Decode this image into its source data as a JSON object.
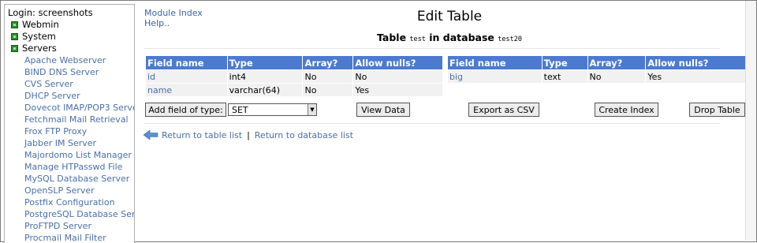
{
  "nav": {
    "login": "Login: screenshots",
    "categories": [
      {
        "label": "Webmin",
        "icon": "category-icon"
      },
      {
        "label": "System",
        "icon": "category-icon"
      },
      {
        "label": "Servers",
        "icon": "category-icon"
      }
    ],
    "modules": [
      "Apache Webserver",
      "BIND DNS Server",
      "CVS Server",
      "DHCP Server",
      "Dovecot IMAP/POP3 Server",
      "Fetchmail Mail Retrieval",
      "Frox FTP Proxy",
      "Jabber IM Server",
      "Majordomo List Manager",
      "Manage HTPasswd File",
      "MySQL Database Server",
      "OpenSLP Server",
      "Postfix Configuration",
      "PostgreSQL Database Server",
      "ProFTPD Server",
      "Procmail Mail Filter"
    ]
  },
  "links": {
    "module_index": "Module Index",
    "help": "Help.."
  },
  "page": {
    "title": "Edit Table",
    "subtitle_prefix": "Table",
    "table_name": "test",
    "subtitle_mid": "in database",
    "database_name": "test20"
  },
  "tables": [
    {
      "headers": [
        "Field name",
        "Type",
        "Array?",
        "Allow nulls?"
      ],
      "rows": [
        [
          "id",
          "int4",
          "No",
          "No"
        ],
        [
          "name",
          "varchar(64)",
          "No",
          "Yes"
        ]
      ]
    },
    {
      "headers": [
        "Field name",
        "Type",
        "Array?",
        "Allow nulls?"
      ],
      "rows": [
        [
          "big",
          "text",
          "No",
          "Yes"
        ]
      ]
    }
  ],
  "actions": {
    "add_field": "Add field of type:",
    "field_type": "SET",
    "view_data": "View Data",
    "export_csv": "Export as CSV",
    "create_index": "Create Index",
    "drop_table": "Drop Table"
  },
  "footer": {
    "return_table_list": "Return to table list",
    "separator": "|",
    "return_database_list": "Return to database list"
  },
  "colors": {
    "header_bg": "#4c7ad1",
    "link": "#4a6fa8",
    "cell_bg": "#f1f1f1"
  }
}
